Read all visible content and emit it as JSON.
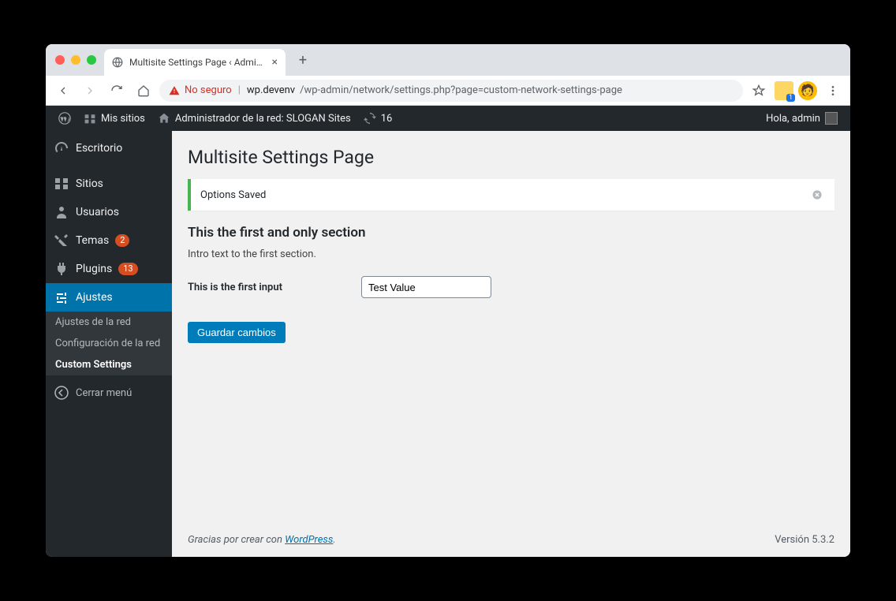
{
  "browser": {
    "tab_title": "Multisite Settings Page ‹ Adminis",
    "new_tab_label": "+",
    "not_secure_label": "No seguro",
    "url_host": "wp.devenv",
    "url_path": "/wp-admin/network/settings.php?page=custom-network-settings-page",
    "ext_badge": "1"
  },
  "adminbar": {
    "my_sites": "Mis sitios",
    "network_admin": "Administrador de la red: SLOGAN Sites",
    "updates_count": "16",
    "greeting": "Hola, admin"
  },
  "sidebar": {
    "items": [
      {
        "label": "Escritorio",
        "icon": "dashboard"
      },
      {
        "label": "Sitios",
        "icon": "sites"
      },
      {
        "label": "Usuarios",
        "icon": "users"
      },
      {
        "label": "Temas",
        "icon": "themes",
        "badge": "2"
      },
      {
        "label": "Plugins",
        "icon": "plugins",
        "badge": "13"
      },
      {
        "label": "Ajustes",
        "icon": "settings",
        "current": true
      }
    ],
    "submenu": [
      {
        "label": "Ajustes de la red"
      },
      {
        "label": "Configuración de la red"
      },
      {
        "label": "Custom Settings",
        "current": true
      }
    ],
    "collapse": "Cerrar menú"
  },
  "page": {
    "title": "Multisite Settings Page",
    "notice": "Options Saved",
    "section_title": "This the first and only section",
    "intro": "Intro text to the first section.",
    "field_label": "This is the first input",
    "field_value": "Test Value",
    "save_button": "Guardar cambios"
  },
  "footer": {
    "thanks_prefix": "Gracias por crear con ",
    "wp_link": "WordPress",
    "thanks_suffix": ".",
    "version": "Versión 5.3.2"
  }
}
